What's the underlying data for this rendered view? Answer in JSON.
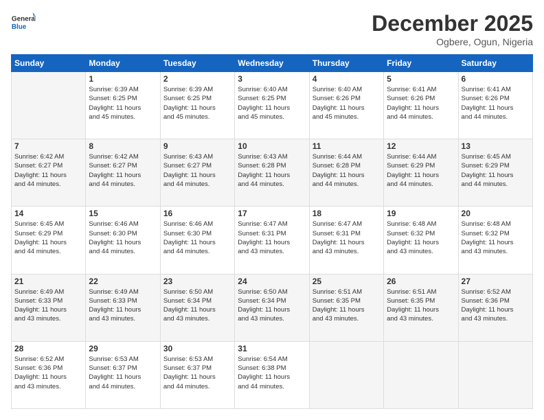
{
  "header": {
    "logo": {
      "general": "General",
      "blue": "Blue"
    },
    "title": "December 2025",
    "location": "Ogbere, Ogun, Nigeria"
  },
  "calendar": {
    "days_of_week": [
      "Sunday",
      "Monday",
      "Tuesday",
      "Wednesday",
      "Thursday",
      "Friday",
      "Saturday"
    ],
    "weeks": [
      [
        {
          "day": "",
          "info": ""
        },
        {
          "day": "1",
          "info": "Sunrise: 6:39 AM\nSunset: 6:25 PM\nDaylight: 11 hours\nand 45 minutes."
        },
        {
          "day": "2",
          "info": "Sunrise: 6:39 AM\nSunset: 6:25 PM\nDaylight: 11 hours\nand 45 minutes."
        },
        {
          "day": "3",
          "info": "Sunrise: 6:40 AM\nSunset: 6:25 PM\nDaylight: 11 hours\nand 45 minutes."
        },
        {
          "day": "4",
          "info": "Sunrise: 6:40 AM\nSunset: 6:26 PM\nDaylight: 11 hours\nand 45 minutes."
        },
        {
          "day": "5",
          "info": "Sunrise: 6:41 AM\nSunset: 6:26 PM\nDaylight: 11 hours\nand 44 minutes."
        },
        {
          "day": "6",
          "info": "Sunrise: 6:41 AM\nSunset: 6:26 PM\nDaylight: 11 hours\nand 44 minutes."
        }
      ],
      [
        {
          "day": "7",
          "info": "Sunrise: 6:42 AM\nSunset: 6:27 PM\nDaylight: 11 hours\nand 44 minutes."
        },
        {
          "day": "8",
          "info": "Sunrise: 6:42 AM\nSunset: 6:27 PM\nDaylight: 11 hours\nand 44 minutes."
        },
        {
          "day": "9",
          "info": "Sunrise: 6:43 AM\nSunset: 6:27 PM\nDaylight: 11 hours\nand 44 minutes."
        },
        {
          "day": "10",
          "info": "Sunrise: 6:43 AM\nSunset: 6:28 PM\nDaylight: 11 hours\nand 44 minutes."
        },
        {
          "day": "11",
          "info": "Sunrise: 6:44 AM\nSunset: 6:28 PM\nDaylight: 11 hours\nand 44 minutes."
        },
        {
          "day": "12",
          "info": "Sunrise: 6:44 AM\nSunset: 6:29 PM\nDaylight: 11 hours\nand 44 minutes."
        },
        {
          "day": "13",
          "info": "Sunrise: 6:45 AM\nSunset: 6:29 PM\nDaylight: 11 hours\nand 44 minutes."
        }
      ],
      [
        {
          "day": "14",
          "info": "Sunrise: 6:45 AM\nSunset: 6:29 PM\nDaylight: 11 hours\nand 44 minutes."
        },
        {
          "day": "15",
          "info": "Sunrise: 6:46 AM\nSunset: 6:30 PM\nDaylight: 11 hours\nand 44 minutes."
        },
        {
          "day": "16",
          "info": "Sunrise: 6:46 AM\nSunset: 6:30 PM\nDaylight: 11 hours\nand 44 minutes."
        },
        {
          "day": "17",
          "info": "Sunrise: 6:47 AM\nSunset: 6:31 PM\nDaylight: 11 hours\nand 43 minutes."
        },
        {
          "day": "18",
          "info": "Sunrise: 6:47 AM\nSunset: 6:31 PM\nDaylight: 11 hours\nand 43 minutes."
        },
        {
          "day": "19",
          "info": "Sunrise: 6:48 AM\nSunset: 6:32 PM\nDaylight: 11 hours\nand 43 minutes."
        },
        {
          "day": "20",
          "info": "Sunrise: 6:48 AM\nSunset: 6:32 PM\nDaylight: 11 hours\nand 43 minutes."
        }
      ],
      [
        {
          "day": "21",
          "info": "Sunrise: 6:49 AM\nSunset: 6:33 PM\nDaylight: 11 hours\nand 43 minutes."
        },
        {
          "day": "22",
          "info": "Sunrise: 6:49 AM\nSunset: 6:33 PM\nDaylight: 11 hours\nand 43 minutes."
        },
        {
          "day": "23",
          "info": "Sunrise: 6:50 AM\nSunset: 6:34 PM\nDaylight: 11 hours\nand 43 minutes."
        },
        {
          "day": "24",
          "info": "Sunrise: 6:50 AM\nSunset: 6:34 PM\nDaylight: 11 hours\nand 43 minutes."
        },
        {
          "day": "25",
          "info": "Sunrise: 6:51 AM\nSunset: 6:35 PM\nDaylight: 11 hours\nand 43 minutes."
        },
        {
          "day": "26",
          "info": "Sunrise: 6:51 AM\nSunset: 6:35 PM\nDaylight: 11 hours\nand 43 minutes."
        },
        {
          "day": "27",
          "info": "Sunrise: 6:52 AM\nSunset: 6:36 PM\nDaylight: 11 hours\nand 43 minutes."
        }
      ],
      [
        {
          "day": "28",
          "info": "Sunrise: 6:52 AM\nSunset: 6:36 PM\nDaylight: 11 hours\nand 43 minutes."
        },
        {
          "day": "29",
          "info": "Sunrise: 6:53 AM\nSunset: 6:37 PM\nDaylight: 11 hours\nand 44 minutes."
        },
        {
          "day": "30",
          "info": "Sunrise: 6:53 AM\nSunset: 6:37 PM\nDaylight: 11 hours\nand 44 minutes."
        },
        {
          "day": "31",
          "info": "Sunrise: 6:54 AM\nSunset: 6:38 PM\nDaylight: 11 hours\nand 44 minutes."
        },
        {
          "day": "",
          "info": ""
        },
        {
          "day": "",
          "info": ""
        },
        {
          "day": "",
          "info": ""
        }
      ]
    ]
  }
}
